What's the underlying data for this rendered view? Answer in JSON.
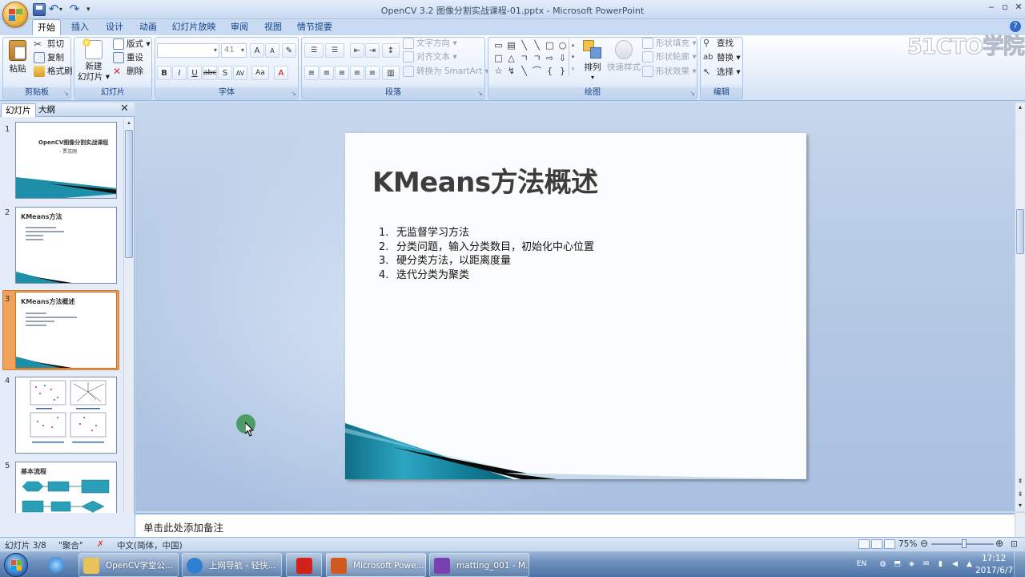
{
  "window": {
    "title": "OpenCV 3.2 图像分割实战课程-01.pptx - Microsoft PowerPoint",
    "controls": {
      "minimize": "‒",
      "maximize": "▫",
      "close": "✕"
    }
  },
  "quick_access": {
    "undo": "↶",
    "redo": "↷",
    "dropdown": "▾",
    "customize": "▾"
  },
  "ribbon_tabs": [
    "开始",
    "插入",
    "设计",
    "动画",
    "幻灯片放映",
    "审阅",
    "视图",
    "情节提要"
  ],
  "ribbon": {
    "clipboard": {
      "label": "剪贴板",
      "paste": "粘贴",
      "cut": "剪切",
      "copy": "复制",
      "format_painter": "格式刷"
    },
    "slides": {
      "label": "幻灯片",
      "new_slide_1": "新建",
      "new_slide_2": "幻灯片 ▾",
      "layout": "版式 ▾",
      "reset": "重设",
      "delete": "删除"
    },
    "font": {
      "label": "字体",
      "font_name": "",
      "font_size": "41",
      "grow": "A",
      "shrink": "A",
      "clear": "✎",
      "bold": "B",
      "italic": "I",
      "underline": "U",
      "strike": "abc",
      "shadow": "S",
      "spacing": "AV",
      "case": "Aa",
      "color": "A"
    },
    "paragraph": {
      "label": "段落",
      "text_direction": "文字方向 ▾",
      "align_text": "对齐文本 ▾",
      "convert_smartart": "转换为 SmartArt ▾"
    },
    "drawing": {
      "label": "绘图",
      "arrange": "排列",
      "quick_styles": "快速样式",
      "shape_fill": "形状填充 ▾",
      "shape_outline": "形状轮廓 ▾",
      "shape_effects": "形状效果 ▾"
    },
    "editing": {
      "label": "编辑",
      "find": "查找",
      "replace": "替换 ▾",
      "select": "选择 ▾"
    },
    "shapes": [
      "▭",
      "▤",
      "╲",
      "╲",
      "□",
      "○",
      "□",
      "△",
      "ㄱ",
      "ㄱ",
      "⇨",
      "⇩",
      "☆",
      "↯",
      "╲",
      "⌒",
      "{",
      "}"
    ]
  },
  "watermark": "51CTO学院",
  "left_pane": {
    "tabs": [
      "幻灯片",
      "大纲"
    ],
    "close": "✕",
    "thumbnails": [
      {
        "num": "1",
        "title": "OpenCV图像分割实战课程",
        "subtitle": "- 贾志刚"
      },
      {
        "num": "2",
        "title": "KMeans方法"
      },
      {
        "num": "3",
        "title": "KMeans方法概述"
      },
      {
        "num": "4",
        "title": ""
      },
      {
        "num": "5",
        "title": "基本流程"
      }
    ]
  },
  "slide": {
    "title": "KMeans方法概述",
    "items": [
      {
        "num": "1.",
        "text": "无监督学习方法"
      },
      {
        "num": "2.",
        "text": "分类问题，输入分类数目，初始化中心位置"
      },
      {
        "num": "3.",
        "text": "硬分类方法，以距离度量"
      },
      {
        "num": "4.",
        "text": "迭代分类为聚类"
      }
    ]
  },
  "notes": {
    "placeholder": "单击此处添加备注"
  },
  "statusbar": {
    "slide_counter": "幻灯片 3/8",
    "theme": "\"聚合\"",
    "language": "中文(简体，中国)",
    "zoom": "75%",
    "zoom_out": "⊖",
    "zoom_in": "⊕",
    "zoom_level": 0.52
  },
  "taskbar": {
    "items": [
      {
        "label": "OpenCV学堂公...",
        "color": "#e8c25a"
      },
      {
        "label": "上网导航 - 轻快...",
        "color": "#2f7fd0"
      },
      {
        "label": "",
        "color": "#d3221b"
      },
      {
        "label": "Microsoft Powe...",
        "color": "#d35a1e"
      },
      {
        "label": "matting_001 - M...",
        "color": "#7a3fb0"
      }
    ],
    "tray_lang": "EN",
    "time": "17:12",
    "date": "2017/6/7"
  },
  "colors": {
    "accent_orange": "#f1a25a",
    "teal_wedge": "#1e8fa8",
    "ribbon_blue": "#15428b"
  }
}
